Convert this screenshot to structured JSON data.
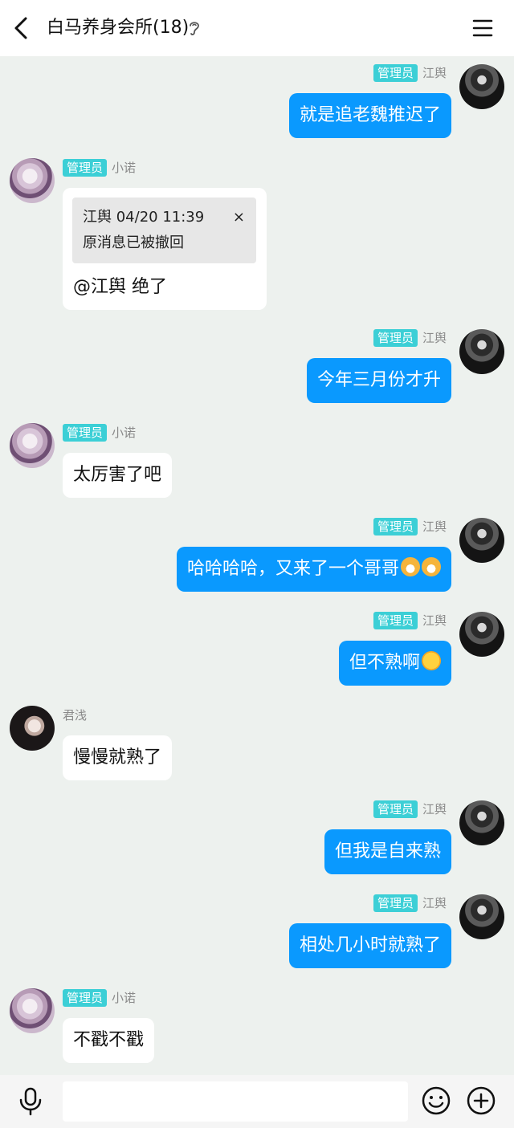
{
  "header": {
    "title": "白马养身会所(18)",
    "back_icon": "chevron-left-icon",
    "ear_icon": "ear-icon",
    "menu_icon": "menu-icon"
  },
  "roles": {
    "admin": "管理员"
  },
  "messages": [
    {
      "sender": "江舆",
      "admin": true,
      "side": "right",
      "text": "就是追老魏推迟了"
    },
    {
      "sender": "小诺",
      "admin": true,
      "side": "left",
      "quote": {
        "header": "江舆 04/20 11:39",
        "close": "×",
        "text": "原消息已被撤回"
      },
      "text": "@江舆 绝了"
    },
    {
      "sender": "江舆",
      "admin": true,
      "side": "right",
      "text": "今年三月份才升"
    },
    {
      "sender": "小诺",
      "admin": true,
      "side": "left",
      "text": "太厉害了吧"
    },
    {
      "sender": "江舆",
      "admin": true,
      "side": "right",
      "text": "哈哈哈哈，又来了一个哥哥",
      "emojis": [
        "dog-emoji",
        "dog-emoji"
      ]
    },
    {
      "sender": "江舆",
      "admin": true,
      "side": "right",
      "text": "但不熟啊",
      "emojis": [
        "crying-laughing-emoji"
      ]
    },
    {
      "sender": "君浅",
      "admin": false,
      "side": "left",
      "text": "慢慢就熟了"
    },
    {
      "sender": "江舆",
      "admin": true,
      "side": "right",
      "text": "但我是自来熟"
    },
    {
      "sender": "江舆",
      "admin": true,
      "side": "right",
      "text": "相处几小时就熟了"
    },
    {
      "sender": "小诺",
      "admin": true,
      "side": "left",
      "text": "不戳不戳"
    }
  ],
  "input_bar": {
    "placeholder": "",
    "icons": [
      "microphone-icon",
      "smiley-icon",
      "plus-circle-icon"
    ]
  },
  "colors": {
    "accent_bubble": "#0a99fe",
    "admin_badge": "#3ccfd6",
    "background": "#edf1ee"
  }
}
